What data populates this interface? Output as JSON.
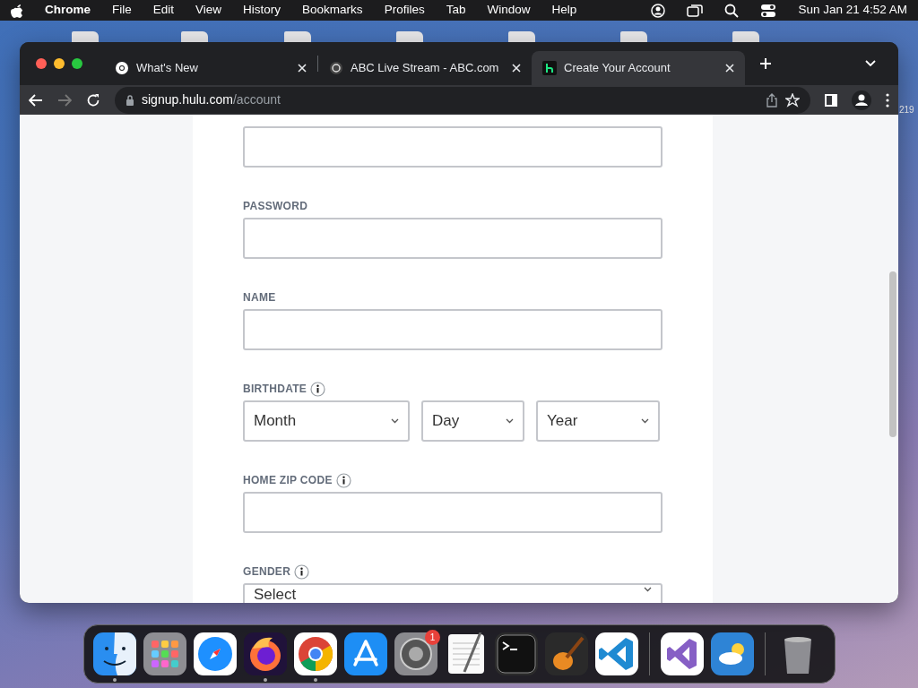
{
  "menubar": {
    "app": "Chrome",
    "menus": [
      "File",
      "Edit",
      "View",
      "History",
      "Bookmarks",
      "Profiles",
      "Tab",
      "Window",
      "Help"
    ],
    "clock": "Sun Jan 21 4:52 AM"
  },
  "desktop": {
    "label": "219"
  },
  "browser": {
    "tabs": [
      {
        "title": "What's New",
        "kind": "chrome",
        "selected": false
      },
      {
        "title": "ABC Live Stream - ABC.com",
        "kind": "abc",
        "selected": false
      },
      {
        "title": "Create Your Account",
        "kind": "hulu",
        "selected": true
      }
    ],
    "url": {
      "host": "signup.hulu.com",
      "path": "/account"
    }
  },
  "form": {
    "fields": [
      {
        "kind": "input"
      },
      {
        "kind": "input",
        "label": "PASSWORD",
        "info": false
      },
      {
        "kind": "input",
        "label": "NAME",
        "info": false
      },
      {
        "kind": "selects",
        "label": "BIRTHDATE",
        "info": true,
        "selects": [
          "Month",
          "Day",
          "Year"
        ]
      },
      {
        "kind": "input",
        "label": "HOME ZIP CODE",
        "info": true
      },
      {
        "kind": "select",
        "label": "GENDER",
        "info": true,
        "value": "Select"
      }
    ]
  },
  "dock": [
    {
      "kind": "finder",
      "running": true
    },
    {
      "kind": "launchpad",
      "running": false
    },
    {
      "kind": "safari",
      "running": false
    },
    {
      "kind": "firefox",
      "running": true
    },
    {
      "kind": "chrome",
      "running": true
    },
    {
      "kind": "appstore",
      "running": false
    },
    {
      "kind": "settings",
      "running": false,
      "badge": "1"
    },
    {
      "kind": "textedit",
      "running": false
    },
    {
      "kind": "terminal",
      "running": false
    },
    {
      "kind": "garageband",
      "running": false
    },
    {
      "kind": "vscode",
      "running": false
    },
    {
      "kind": "separator"
    },
    {
      "kind": "vs",
      "running": false
    },
    {
      "kind": "weather",
      "running": false
    },
    {
      "kind": "separator"
    },
    {
      "kind": "trash",
      "running": false
    }
  ]
}
